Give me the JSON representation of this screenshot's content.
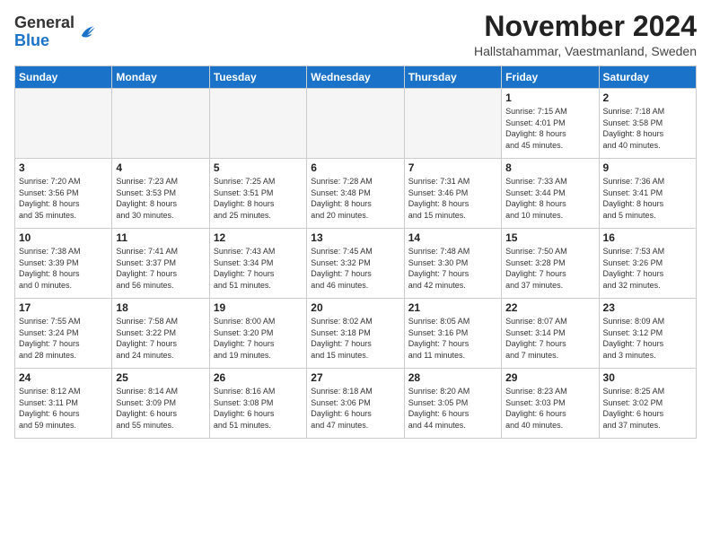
{
  "logo": {
    "line1": "General",
    "line2": "Blue"
  },
  "title": "November 2024",
  "location": "Hallstahammar, Vaestmanland, Sweden",
  "weekdays": [
    "Sunday",
    "Monday",
    "Tuesday",
    "Wednesday",
    "Thursday",
    "Friday",
    "Saturday"
  ],
  "weeks": [
    [
      {
        "day": "",
        "info": ""
      },
      {
        "day": "",
        "info": ""
      },
      {
        "day": "",
        "info": ""
      },
      {
        "day": "",
        "info": ""
      },
      {
        "day": "",
        "info": ""
      },
      {
        "day": "1",
        "info": "Sunrise: 7:15 AM\nSunset: 4:01 PM\nDaylight: 8 hours\nand 45 minutes."
      },
      {
        "day": "2",
        "info": "Sunrise: 7:18 AM\nSunset: 3:58 PM\nDaylight: 8 hours\nand 40 minutes."
      }
    ],
    [
      {
        "day": "3",
        "info": "Sunrise: 7:20 AM\nSunset: 3:56 PM\nDaylight: 8 hours\nand 35 minutes."
      },
      {
        "day": "4",
        "info": "Sunrise: 7:23 AM\nSunset: 3:53 PM\nDaylight: 8 hours\nand 30 minutes."
      },
      {
        "day": "5",
        "info": "Sunrise: 7:25 AM\nSunset: 3:51 PM\nDaylight: 8 hours\nand 25 minutes."
      },
      {
        "day": "6",
        "info": "Sunrise: 7:28 AM\nSunset: 3:48 PM\nDaylight: 8 hours\nand 20 minutes."
      },
      {
        "day": "7",
        "info": "Sunrise: 7:31 AM\nSunset: 3:46 PM\nDaylight: 8 hours\nand 15 minutes."
      },
      {
        "day": "8",
        "info": "Sunrise: 7:33 AM\nSunset: 3:44 PM\nDaylight: 8 hours\nand 10 minutes."
      },
      {
        "day": "9",
        "info": "Sunrise: 7:36 AM\nSunset: 3:41 PM\nDaylight: 8 hours\nand 5 minutes."
      }
    ],
    [
      {
        "day": "10",
        "info": "Sunrise: 7:38 AM\nSunset: 3:39 PM\nDaylight: 8 hours\nand 0 minutes."
      },
      {
        "day": "11",
        "info": "Sunrise: 7:41 AM\nSunset: 3:37 PM\nDaylight: 7 hours\nand 56 minutes."
      },
      {
        "day": "12",
        "info": "Sunrise: 7:43 AM\nSunset: 3:34 PM\nDaylight: 7 hours\nand 51 minutes."
      },
      {
        "day": "13",
        "info": "Sunrise: 7:45 AM\nSunset: 3:32 PM\nDaylight: 7 hours\nand 46 minutes."
      },
      {
        "day": "14",
        "info": "Sunrise: 7:48 AM\nSunset: 3:30 PM\nDaylight: 7 hours\nand 42 minutes."
      },
      {
        "day": "15",
        "info": "Sunrise: 7:50 AM\nSunset: 3:28 PM\nDaylight: 7 hours\nand 37 minutes."
      },
      {
        "day": "16",
        "info": "Sunrise: 7:53 AM\nSunset: 3:26 PM\nDaylight: 7 hours\nand 32 minutes."
      }
    ],
    [
      {
        "day": "17",
        "info": "Sunrise: 7:55 AM\nSunset: 3:24 PM\nDaylight: 7 hours\nand 28 minutes."
      },
      {
        "day": "18",
        "info": "Sunrise: 7:58 AM\nSunset: 3:22 PM\nDaylight: 7 hours\nand 24 minutes."
      },
      {
        "day": "19",
        "info": "Sunrise: 8:00 AM\nSunset: 3:20 PM\nDaylight: 7 hours\nand 19 minutes."
      },
      {
        "day": "20",
        "info": "Sunrise: 8:02 AM\nSunset: 3:18 PM\nDaylight: 7 hours\nand 15 minutes."
      },
      {
        "day": "21",
        "info": "Sunrise: 8:05 AM\nSunset: 3:16 PM\nDaylight: 7 hours\nand 11 minutes."
      },
      {
        "day": "22",
        "info": "Sunrise: 8:07 AM\nSunset: 3:14 PM\nDaylight: 7 hours\nand 7 minutes."
      },
      {
        "day": "23",
        "info": "Sunrise: 8:09 AM\nSunset: 3:12 PM\nDaylight: 7 hours\nand 3 minutes."
      }
    ],
    [
      {
        "day": "24",
        "info": "Sunrise: 8:12 AM\nSunset: 3:11 PM\nDaylight: 6 hours\nand 59 minutes."
      },
      {
        "day": "25",
        "info": "Sunrise: 8:14 AM\nSunset: 3:09 PM\nDaylight: 6 hours\nand 55 minutes."
      },
      {
        "day": "26",
        "info": "Sunrise: 8:16 AM\nSunset: 3:08 PM\nDaylight: 6 hours\nand 51 minutes."
      },
      {
        "day": "27",
        "info": "Sunrise: 8:18 AM\nSunset: 3:06 PM\nDaylight: 6 hours\nand 47 minutes."
      },
      {
        "day": "28",
        "info": "Sunrise: 8:20 AM\nSunset: 3:05 PM\nDaylight: 6 hours\nand 44 minutes."
      },
      {
        "day": "29",
        "info": "Sunrise: 8:23 AM\nSunset: 3:03 PM\nDaylight: 6 hours\nand 40 minutes."
      },
      {
        "day": "30",
        "info": "Sunrise: 8:25 AM\nSunset: 3:02 PM\nDaylight: 6 hours\nand 37 minutes."
      }
    ]
  ]
}
